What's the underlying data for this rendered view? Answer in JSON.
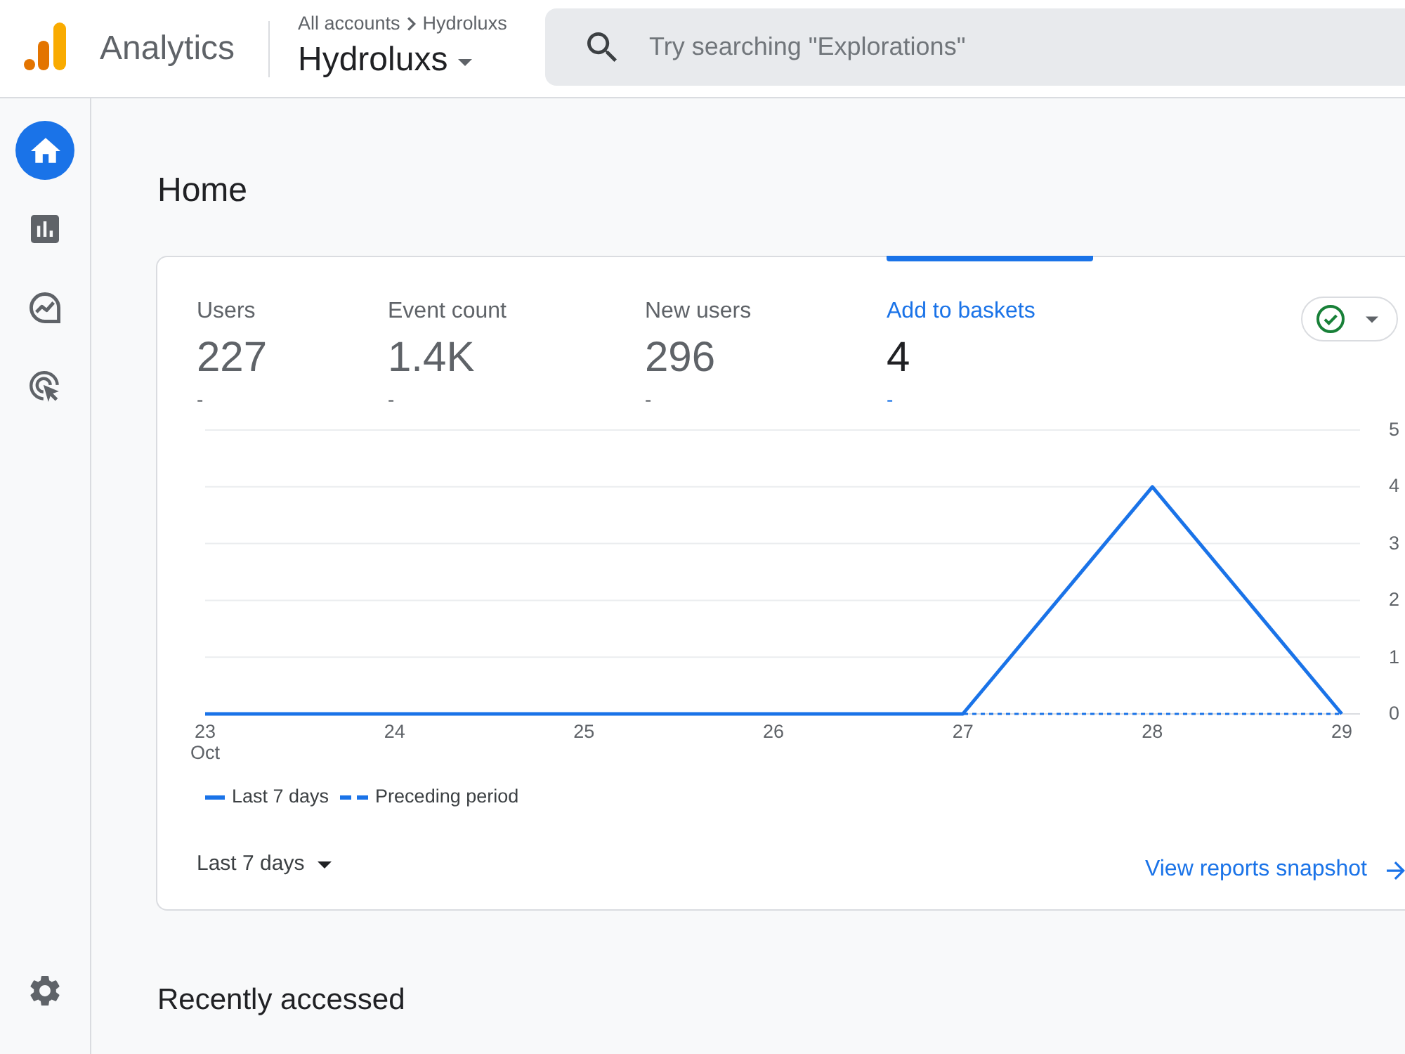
{
  "header": {
    "app_name": "Analytics",
    "breadcrumb": [
      "All accounts",
      "Hydroluxs"
    ],
    "property": "Hydroluxs",
    "search": {
      "placeholder": "Try searching \"Explorations\""
    }
  },
  "sidebar": {
    "items": [
      {
        "selected": true
      },
      {
        "selected": false
      },
      {
        "selected": false
      },
      {
        "selected": false
      }
    ]
  },
  "page_title": "Home",
  "overview_card": {
    "metrics": [
      {
        "label": "Users",
        "value": "227",
        "change": "-",
        "selected": false
      },
      {
        "label": "Event count",
        "value": "1.4K",
        "change": "-",
        "selected": false
      },
      {
        "label": "New users",
        "value": "296",
        "change": "-",
        "selected": false
      },
      {
        "label": "Add to baskets",
        "value": "4",
        "change": "-",
        "selected": true
      }
    ],
    "chart_data": [
      {
        "type": "line",
        "categories": [
          "23 Oct",
          "24",
          "25",
          "26",
          "27",
          "28",
          "29"
        ],
        "series": [
          {
            "name": "Last 7 days",
            "color": "#1a73e8",
            "values": [
              0,
              0,
              0,
              0,
              0,
              4,
              0
            ]
          },
          {
            "name": "Preceding period",
            "color": "#1a73e8",
            "line_style": "dashed",
            "values": [
              0,
              0,
              0,
              0,
              0,
              0,
              0
            ]
          }
        ],
        "ylim": [
          0,
          5
        ],
        "yticks": [
          0,
          1,
          2,
          3,
          4,
          5
        ],
        "grid": true
      }
    ],
    "date_range": "Last 7 days",
    "link": "View reports snapshot"
  },
  "section_title": "Recently accessed"
}
